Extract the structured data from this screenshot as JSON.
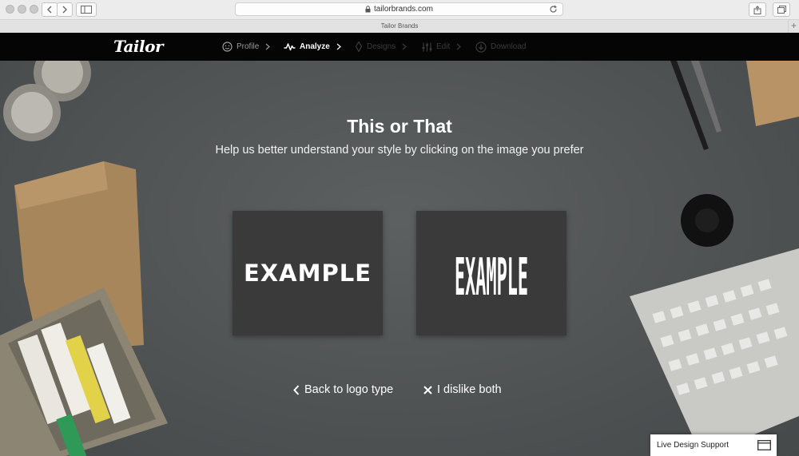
{
  "browser": {
    "url": "tailorbrands.com",
    "tab_title": "Tailor Brands",
    "new_tab_label": "+"
  },
  "nav": {
    "logo": "Tailor",
    "steps": [
      {
        "label": "Profile",
        "icon": "face-icon",
        "state": "done"
      },
      {
        "label": "Analyze",
        "icon": "pulse-icon",
        "state": "active"
      },
      {
        "label": "Designs",
        "icon": "pen-icon",
        "state": "disabled"
      },
      {
        "label": "Edit",
        "icon": "sliders-icon",
        "state": "disabled"
      },
      {
        "label": "Download",
        "icon": "download-icon",
        "state": "disabled"
      }
    ]
  },
  "main": {
    "title": "This or That",
    "subtitle": "Help us better understand your style by clicking on the image you prefer",
    "option_a_text": "EXAMPLE",
    "option_b_text": "EXAMPLE",
    "back_label": "Back to logo type",
    "dislike_label": "I dislike both"
  },
  "support": {
    "label": "Live Design Support"
  },
  "colors": {
    "nav_bg": "#050505",
    "card_bg": "#3a3a3a",
    "scene_bg": "#505354"
  }
}
